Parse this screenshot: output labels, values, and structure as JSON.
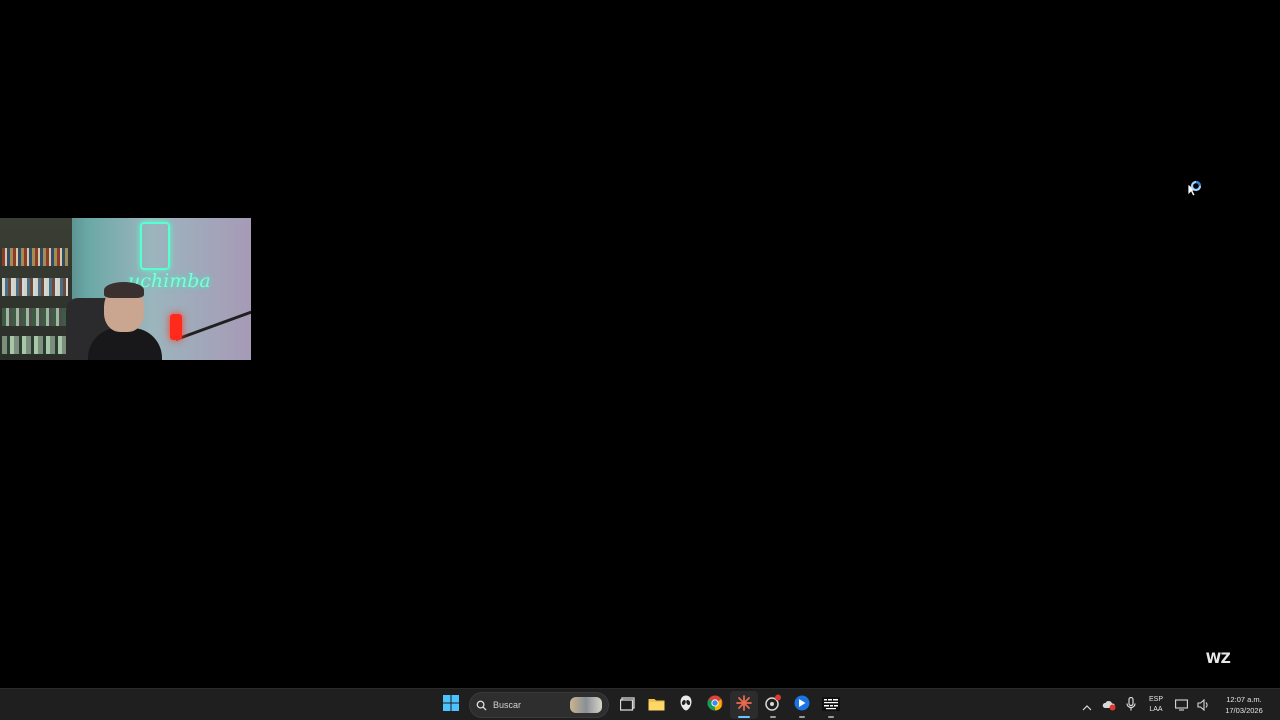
{
  "taskbar": {
    "search_label": "Buscar",
    "pinned": [
      {
        "name": "start",
        "icon": "windows-logo-icon"
      },
      {
        "name": "task-view",
        "icon": "task-view-icon"
      },
      {
        "name": "file-explorer",
        "icon": "folder-icon"
      },
      {
        "name": "alienware",
        "icon": "alien-icon"
      },
      {
        "name": "chrome",
        "icon": "chrome-icon"
      },
      {
        "name": "app-burst",
        "icon": "burst-icon"
      },
      {
        "name": "app-steam-like",
        "icon": "gear-badge-icon"
      },
      {
        "name": "app-blue",
        "icon": "blue-app-icon"
      },
      {
        "name": "call-of-duty",
        "icon": "cod-icon"
      }
    ],
    "tray": {
      "language_line1": "ESP",
      "language_line2": "LAA",
      "time": "12:07 a.m.",
      "date": "17/03/2026"
    }
  },
  "overlay": {
    "watermark": "WZ",
    "neon_sign": "uchimba"
  },
  "colors": {
    "desktop_bg": "#000000",
    "taskbar_bg": "#1f1f1f",
    "accent": "#6cc2ff",
    "neon": "#58ffd0"
  }
}
